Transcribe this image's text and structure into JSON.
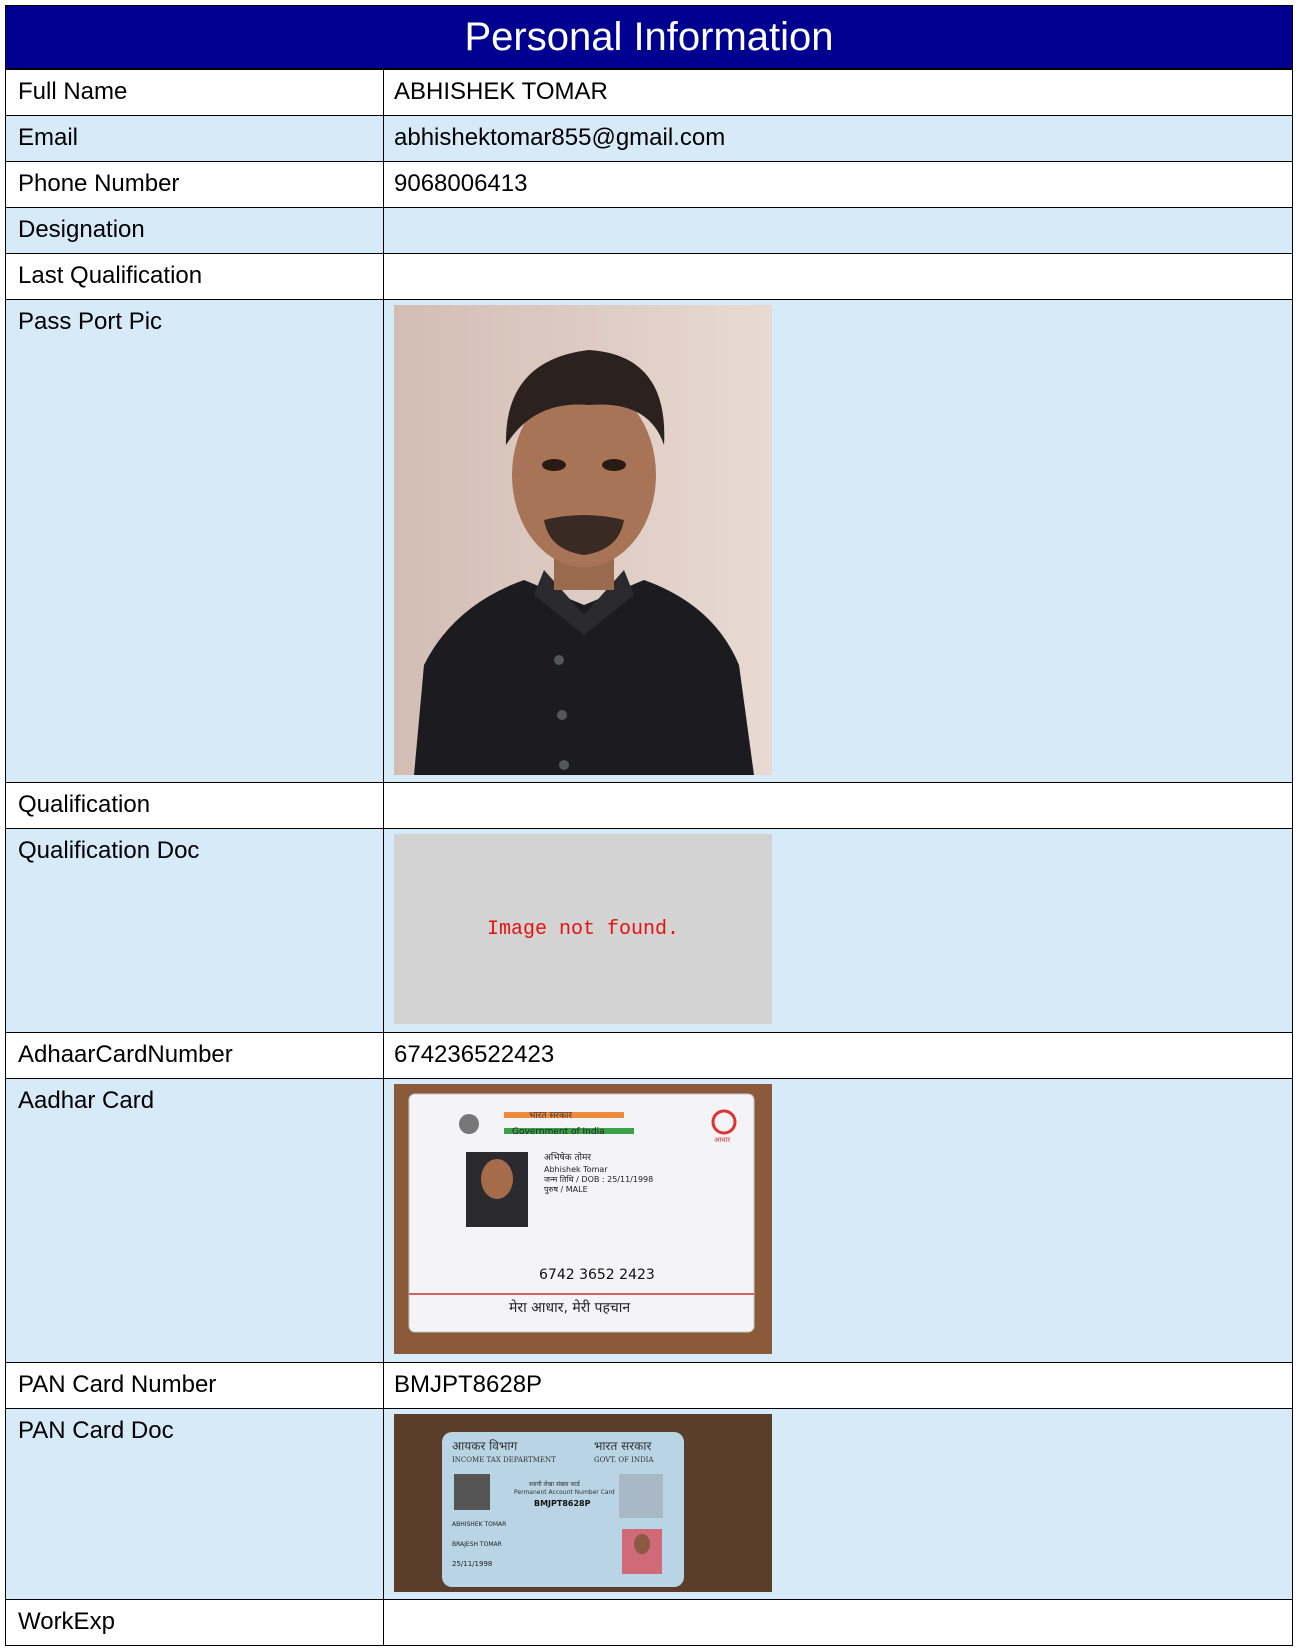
{
  "header": {
    "title": "Personal Information"
  },
  "rows": {
    "full_name": {
      "label": "Full Name",
      "value": "ABHISHEK TOMAR"
    },
    "email": {
      "label": "Email",
      "value": "abhishektomar855@gmail.com"
    },
    "phone": {
      "label": "Phone Number",
      "value": "9068006413"
    },
    "designation": {
      "label": "Designation",
      "value": ""
    },
    "last_qualification": {
      "label": "Last Qualification",
      "value": ""
    },
    "passport_pic": {
      "label": "Pass Port Pic"
    },
    "qualification": {
      "label": "Qualification",
      "value": ""
    },
    "qualification_doc": {
      "label": "Qualification Doc",
      "placeholder": "Image not found."
    },
    "aadhaar_number": {
      "label": "AdhaarCardNumber",
      "value": "674236522423"
    },
    "aadhaar_card": {
      "label": "Aadhar Card",
      "card": {
        "gov_hindi": "भारत सरकार",
        "gov_english": "Government of India",
        "name_hindi": "अभिषेक तोमर",
        "name_english": "Abhishek Tomar",
        "dob": "जन्म तिथि / DOB : 25/11/1998",
        "gender": "पुरुष / MALE",
        "number": "6742 3652 2423",
        "tagline": "मेरा आधार, मेरी पहचान",
        "logo_text": "आधार"
      }
    },
    "pan_number": {
      "label": "PAN Card Number",
      "value": "BMJPT8628P"
    },
    "pan_doc": {
      "label": "PAN Card Doc",
      "card": {
        "dept_hindi": "आयकर विभाग",
        "dept_english": "INCOME TAX DEPARTMENT",
        "gov_hindi": "भारत सरकार",
        "gov_english": "GOVT. OF INDIA",
        "card_hindi": "स्थायी लेखा संख्या कार्ड",
        "card_english": "Permanent Account Number Card",
        "pan": "BMJPT8628P",
        "name": "ABHISHEK TOMAR",
        "father": "BRAJESH TOMAR",
        "dob": "25/11/1998"
      }
    },
    "work_exp": {
      "label": "WorkExp",
      "value": ""
    }
  },
  "colors": {
    "header_bg": "#000090",
    "row_alt": "#d6eaf8",
    "not_found_text": "#e41111"
  }
}
